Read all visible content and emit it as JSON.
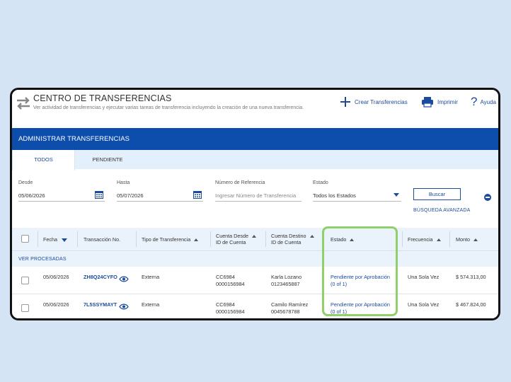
{
  "header": {
    "title": "CENTRO DE TRANSFERENCIAS",
    "subtitle": "Ver actividad de transferencias y ejecutar varias tareas de transferencia incluyendo la creación de una nueva transferencia.",
    "actions": {
      "create": "Crear Transferencias",
      "print": "Imprimir",
      "help": "Ayuda"
    }
  },
  "section_title": "ADMINISTRAR TRANSFERENCIAS",
  "tabs": [
    {
      "label": "TODOS",
      "active": true
    },
    {
      "label": "PENDIENTE",
      "active": false
    }
  ],
  "filters": {
    "desde": {
      "label": "Desde",
      "value": "05/06/2026"
    },
    "hasta": {
      "label": "Hasta",
      "value": "05/07/2026"
    },
    "referencia": {
      "label": "Número de Referencia",
      "placeholder": "Ingresar Número de Transferencia"
    },
    "estado": {
      "label": "Estado",
      "value": "Todos los Estados"
    },
    "search_button": "Buscar",
    "advanced_link": "BÚSQUEDA AVANZADA"
  },
  "table": {
    "columns": {
      "fecha": "Fecha",
      "transaccion": "Transacción No.",
      "tipo": "Tipo de Transferencia",
      "cuenta_desde_1": "Cuenta Desde",
      "cuenta_desde_2": "ID de Cuenta",
      "cuenta_destino_1": "Cuenta Destino",
      "cuenta_destino_2": "ID de Cuenta",
      "estado": "Estado",
      "frecuencia": "Frecuencia",
      "monto": "Monto"
    },
    "group_label": "VER PROCESADAS",
    "rows": [
      {
        "fecha": "05/06/2026",
        "transaccion": "ZH8Q24CYFO",
        "tipo": "Externa",
        "desde_id": "CC6984",
        "desde_cuenta": "0000156984",
        "destino_nombre": "Karla Lozano",
        "destino_cuenta": "0123465887",
        "estado_1": "Pendiente por Aprobación",
        "estado_2": "(0 of 1)",
        "frecuencia": "Una Sola Vez",
        "monto": "$ 574.313,00"
      },
      {
        "fecha": "05/06/2026",
        "transaccion": "7L5SSYMAYT",
        "tipo": "Externa",
        "desde_id": "CC6984",
        "desde_cuenta": "0000156984",
        "destino_nombre": "Camilo Ramírez",
        "destino_cuenta": "0045678788",
        "estado_1": "Pendiente por Aprobación",
        "estado_2": "(0 of 1)",
        "frecuencia": "Una Sola Vez",
        "monto": "$ 467.824,00"
      }
    ]
  },
  "colors": {
    "brand_blue": "#0d4ead",
    "link_blue": "#1a4b9c",
    "highlight_green": "#8fd06b",
    "background": "#d4e4f5"
  }
}
